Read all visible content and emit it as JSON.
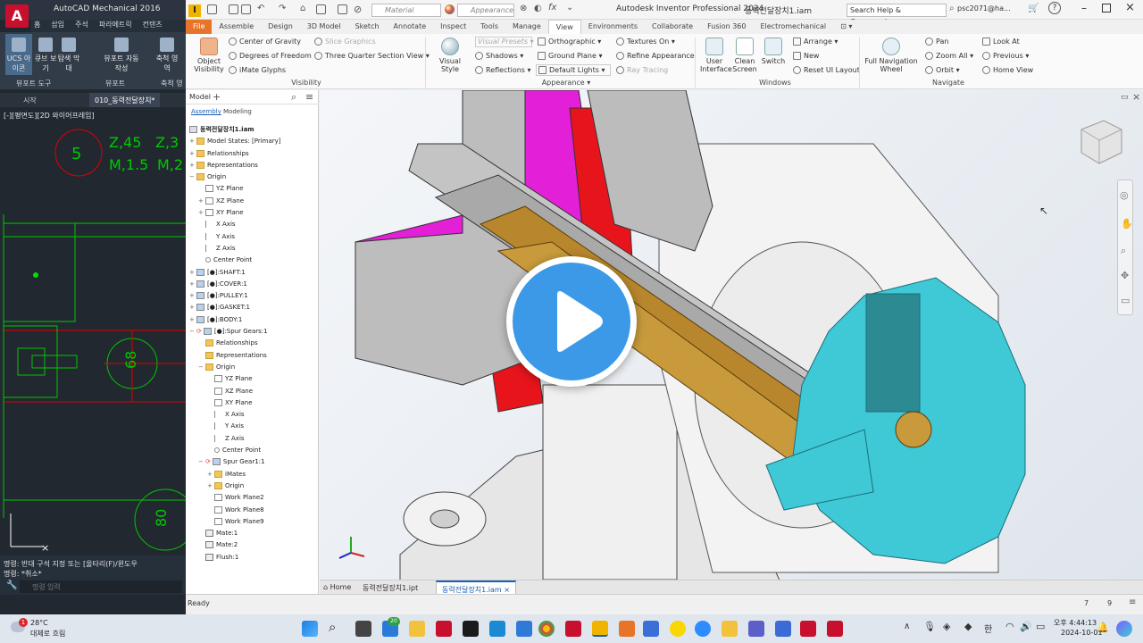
{
  "acad": {
    "logo": "A",
    "title": "AutoCAD Mechanical 2016",
    "tabs": [
      "홈",
      "삽입",
      "주석",
      "파라메트릭",
      "컨텐츠"
    ],
    "buttons": [
      "UCS 아이콘",
      "큐브 보기",
      "탐색 막대",
      "뷰포트 자동 작성",
      "축척 영역",
      "축척"
    ],
    "panels": [
      "뷰포트 도구",
      "뷰포트",
      "축척 영"
    ],
    "doctabs": [
      "시작",
      "010_동력전달장치*"
    ],
    "viewlabel": "[-][평면도][2D 와이어프레임]",
    "labels": {
      "l5": "5",
      "z45": "Z,45",
      "z3": "Z,3",
      "m15": "M,1.5",
      "m2": "M,2",
      "d68": "68",
      "d80": "80"
    },
    "cmd1": "명령: 반대 구석 지정 또는 [울타리(F)/윈도우",
    "cmd2": "명령: *취소*",
    "cmd_placeholder": "명령 입력"
  },
  "inv": {
    "logo": "I",
    "material_placeholder": "Material",
    "appearance_placeholder": "Appearance",
    "app_title": "Autodesk Inventor Professional 2024",
    "doc_title": "동력전달장치1.iam",
    "search": "Search Help & Commands...",
    "user": "psc2071@ha...",
    "help": "?",
    "tabs": [
      "File",
      "Assemble",
      "Design",
      "3D Model",
      "Sketch",
      "Annotate",
      "Inspect",
      "Tools",
      "Manage",
      "View",
      "Environments",
      "Collaborate",
      "Fusion 360",
      "Electromechanical"
    ],
    "active_tab": "View",
    "ribbon": {
      "object_visibility": "Object Visibility",
      "center_gravity": "Center of Gravity",
      "dof": "Degrees of Freedom",
      "imate": "iMate Glyphs",
      "slice": "Slice Graphics",
      "three_quarter": "Three Quarter Section View",
      "visibility_panel": "Visibility",
      "visual_style": "Visual Style",
      "visual_presets": "Visual Presets",
      "orthographic": "Orthographic",
      "shadows": "Shadows",
      "reflections": "Reflections",
      "ground_plane": "Ground Plane",
      "default_lights": "Default Lights",
      "textures_on": "Textures On",
      "refine": "Refine Appearance",
      "ray_tracing": "Ray Tracing",
      "appearance_panel": "Appearance",
      "user_interface": "User Interface",
      "clean_screen": "Clean Screen",
      "switch": "Switch",
      "arrange": "Arrange",
      "new": "New",
      "reset_ui": "Reset UI Layout",
      "windows_panel": "Windows",
      "full_nav": "Full Navigation Wheel",
      "pan": "Pan",
      "zoom_all": "Zoom All",
      "orbit": "Orbit",
      "look_at": "Look At",
      "previous": "Previous",
      "home_view": "Home View",
      "navigate_panel": "Navigate"
    },
    "browser": {
      "title": "Model",
      "sub_tabs": [
        "Assembly",
        "Modeling"
      ],
      "items": [
        "동력전달장치1.iam",
        "Model States: [Primary]",
        "Relationships",
        "Representations",
        "Origin",
        "YZ Plane",
        "XZ Plane",
        "XY Plane",
        "X Axis",
        "Y Axis",
        "Z Axis",
        "Center Point",
        "[●]:SHAFT:1",
        "[●]:COVER:1",
        "[●]:PULLEY:1",
        "[●]:GASKET:1",
        "[●]:BODY:1",
        "[●]:Spur Gears:1",
        "Relationships",
        "Representations",
        "Origin",
        "YZ Plane",
        "XZ Plane",
        "XY Plane",
        "X Axis",
        "Y Axis",
        "Z Axis",
        "Center Point",
        "Spur Gear1:1",
        "iMates",
        "Origin",
        "Work Plane2",
        "Work Plane8",
        "Work Plane9",
        "Mate:1",
        "Mate:2",
        "Flush:1"
      ]
    },
    "doctabs": {
      "home": "Home",
      "tab1": "동력전달장치1.ipt",
      "tab2": "동력전달장치1.iam"
    },
    "status": {
      "left": "Ready",
      "n1": "7",
      "n2": "9"
    }
  },
  "taskbar": {
    "weather_temp": "28°C",
    "weather_desc": "대체로 흐림",
    "badge": "1",
    "badge2": "20",
    "ime": "한",
    "ampm": "오후",
    "time": "4:44:13",
    "date": "2024-10-01"
  },
  "colors": {
    "accent": "#e8742a",
    "play": "#3b99e8",
    "magenta": "#e31fd8",
    "gear": "#3fc8d6",
    "brass": "#b8862c",
    "cad_green": "#00c800",
    "cad_red": "#e00000"
  }
}
